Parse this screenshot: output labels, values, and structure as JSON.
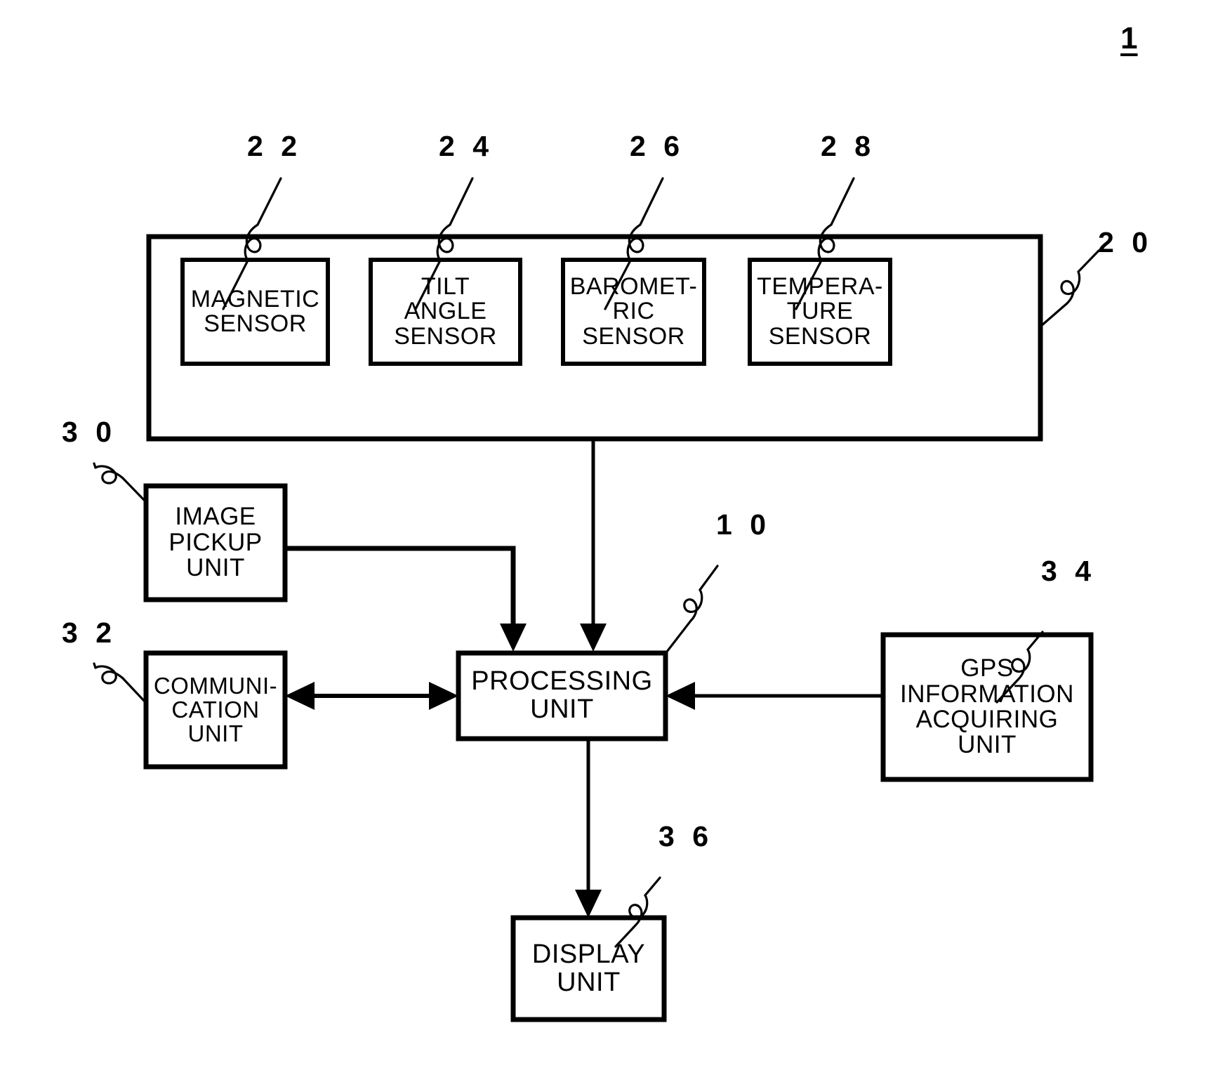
{
  "figure": {
    "number": "1",
    "title_ref": "1"
  },
  "blocks": [
    {
      "id": "magnetic-sensor",
      "ref": "2 2",
      "lines": [
        "MAGNETIC",
        "SENSOR"
      ],
      "font_size": 34
    },
    {
      "id": "tilt-angle-sensor",
      "ref": "2 4",
      "lines": [
        "TILT",
        "ANGLE",
        "SENSOR"
      ],
      "font_size": 34
    },
    {
      "id": "barometric-sensor",
      "ref": "2 6",
      "lines": [
        "BAROMET-",
        "RIC",
        "SENSOR"
      ],
      "font_size": 34
    },
    {
      "id": "temperature-sensor",
      "ref": "2 8",
      "lines": [
        "TEMPERA-",
        "TURE",
        "SENSOR"
      ],
      "font_size": 34
    },
    {
      "id": "sensor-unit-container",
      "ref": "2 0",
      "lines": [],
      "font_size": 0
    },
    {
      "id": "image-pickup-unit",
      "ref": "3 0",
      "lines": [
        "IMAGE",
        "PICKUP",
        "UNIT"
      ],
      "font_size": 35
    },
    {
      "id": "communication-unit",
      "ref": "3 2",
      "lines": [
        "COMMUNI-",
        "CATION",
        "UNIT"
      ],
      "font_size": 35
    },
    {
      "id": "processing-unit",
      "ref": "1 0",
      "lines": [
        "PROCESSING",
        "UNIT"
      ],
      "font_size": 38
    },
    {
      "id": "gps-information-acquiring-unit",
      "ref": "3 4",
      "lines": [
        "GPS",
        "INFORMATION",
        "ACQUIRING",
        "UNIT"
      ],
      "font_size": 35
    },
    {
      "id": "display-unit",
      "ref": "3 6",
      "lines": [
        "DISPLAY",
        "UNIT"
      ],
      "font_size": 38
    }
  ],
  "colors": {
    "ink": "#000000",
    "paper": "#ffffff"
  }
}
